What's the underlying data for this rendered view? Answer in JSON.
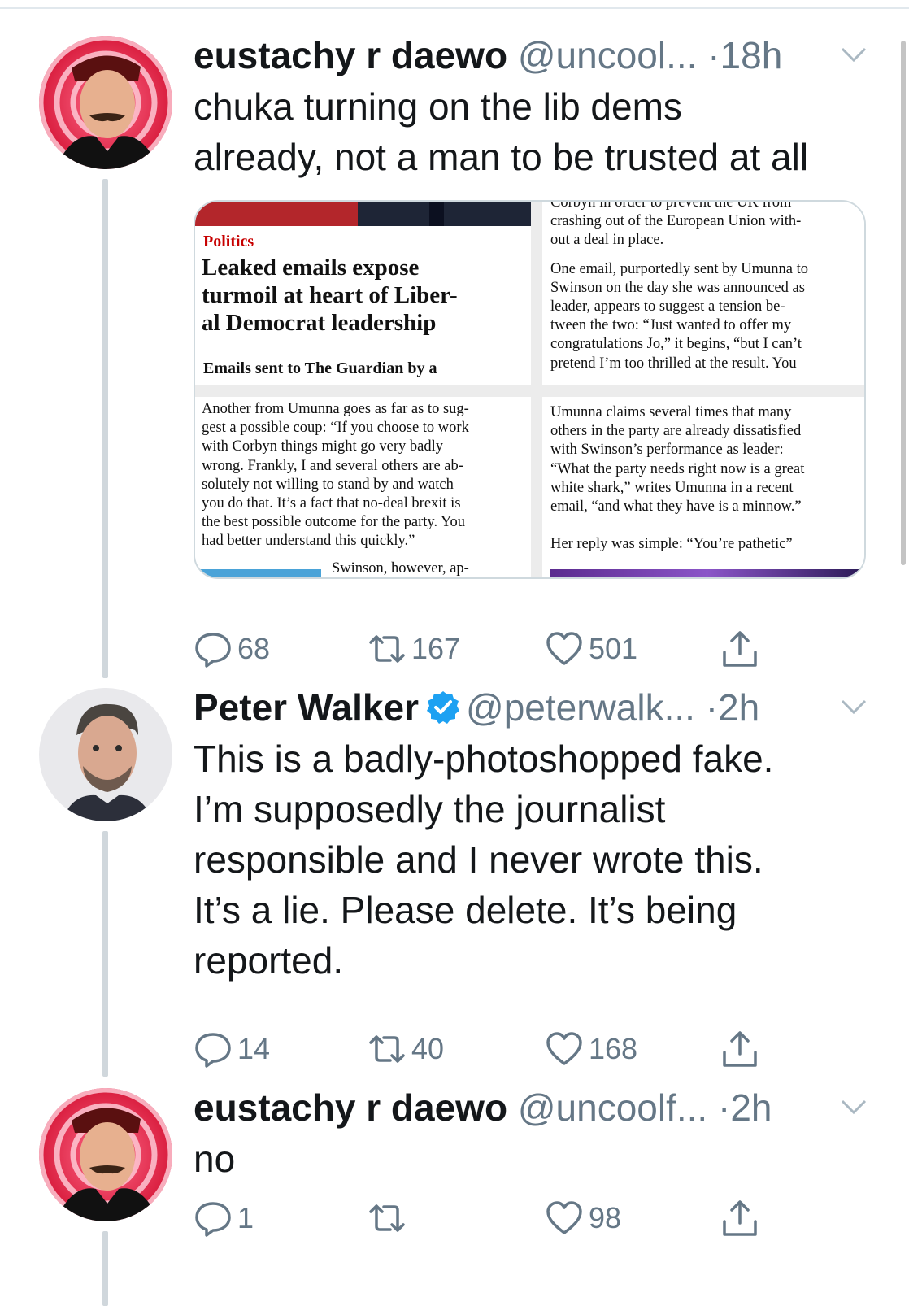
{
  "tweets": [
    {
      "name": "eustachy r daewo",
      "handle": "@uncool...",
      "dot": "·",
      "time": "18h",
      "text_lines": [
        "chuka turning on the lib dems",
        "already, not a man to be trusted at all"
      ],
      "counts": {
        "reply": "68",
        "retweet": "167",
        "like": "501"
      },
      "avatar_icon": "red-hypno-portrait-avatar"
    },
    {
      "name": "Peter Walker",
      "handle": "@peterwalk...",
      "dot": "·",
      "time": "2h",
      "text_lines": [
        "This is a badly-photoshopped fake.",
        "I’m supposedly the journalist",
        "responsible and I never wrote this.",
        "It’s a lie. Please delete. It’s being",
        "reported."
      ],
      "counts": {
        "reply": "14",
        "retweet": "40",
        "like": "168"
      },
      "verified_icon": "verified-badge-icon",
      "avatar_icon": "portrait-avatar"
    },
    {
      "name": "eustachy r daewo",
      "handle": "@uncoolf...",
      "dot": "·",
      "time": "2h",
      "text_lines": [
        "no"
      ],
      "counts": {
        "reply": "1",
        "retweet": "",
        "like": "98"
      },
      "avatar_icon": "red-hypno-portrait-avatar"
    }
  ],
  "article": {
    "section": "Politics",
    "headline": [
      "Leaked emails expose",
      "turmoil at heart of Liber-",
      "al Democrat leadership"
    ],
    "standfirst": "Emails sent to The Guardian by a",
    "top_right": [
      "Corbyn in order to prevent the UK from",
      "crashing out of the European Union with-",
      "out a deal in place.",
      "",
      "One email, purportedly sent by Umunna to",
      "Swinson on the day she was announced as",
      "leader, appears to suggest a tension be-",
      "tween the two: “Just wanted to offer my",
      "congratulations Jo,” it begins, “but I can’t",
      "pretend I’m too thrilled at the result. You"
    ],
    "bottom_left": [
      "Another from Umunna goes as far as to sug-",
      "gest a possible coup: “If you choose to work",
      "with Corbyn things might go very badly",
      "wrong. Frankly, I and several others are ab-",
      "solutely not willing to stand by and watch",
      "you do that. It’s a fact that no-deal brexit is",
      "the best possible outcome for the party. You",
      "had better understand this quickly.”"
    ],
    "bottom_left_tail": "Swinson, however, ap-",
    "bottom_right": [
      "Umunna claims several times that many",
      "others in the party are already dissatisfied",
      "with Swinson’s performance as leader:",
      "“What the party needs right now is a great",
      "white shark,” writes Umunna in a recent",
      "email, “and what they have is a minnow.”"
    ],
    "bottom_right_tail": "Her reply was simple: “You’re pathetic”"
  },
  "colors": {
    "accent": "#1da1f2",
    "text": "#14171a",
    "secondary": "#657786",
    "border": "#cfd9de",
    "politics_red": "#c70000"
  }
}
